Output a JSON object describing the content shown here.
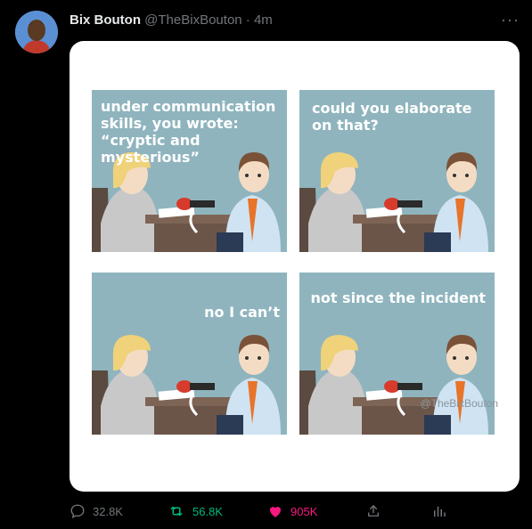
{
  "tweet": {
    "author_name": "Bix Bouton",
    "author_handle": "@TheBixBouton",
    "separator": "·",
    "time": "4m",
    "more_label": "···"
  },
  "comic": {
    "panels": [
      {
        "text": "under communication skills, you wrote: “cryptic and mysterious”"
      },
      {
        "text": "could you elaborate on that?"
      },
      {
        "text": "no I can’t"
      },
      {
        "text": "not since the incident"
      }
    ],
    "watermark": "@TheBixBouton"
  },
  "actions": {
    "replies": "32.8K",
    "retweets": "56.8K",
    "likes": "905K"
  }
}
